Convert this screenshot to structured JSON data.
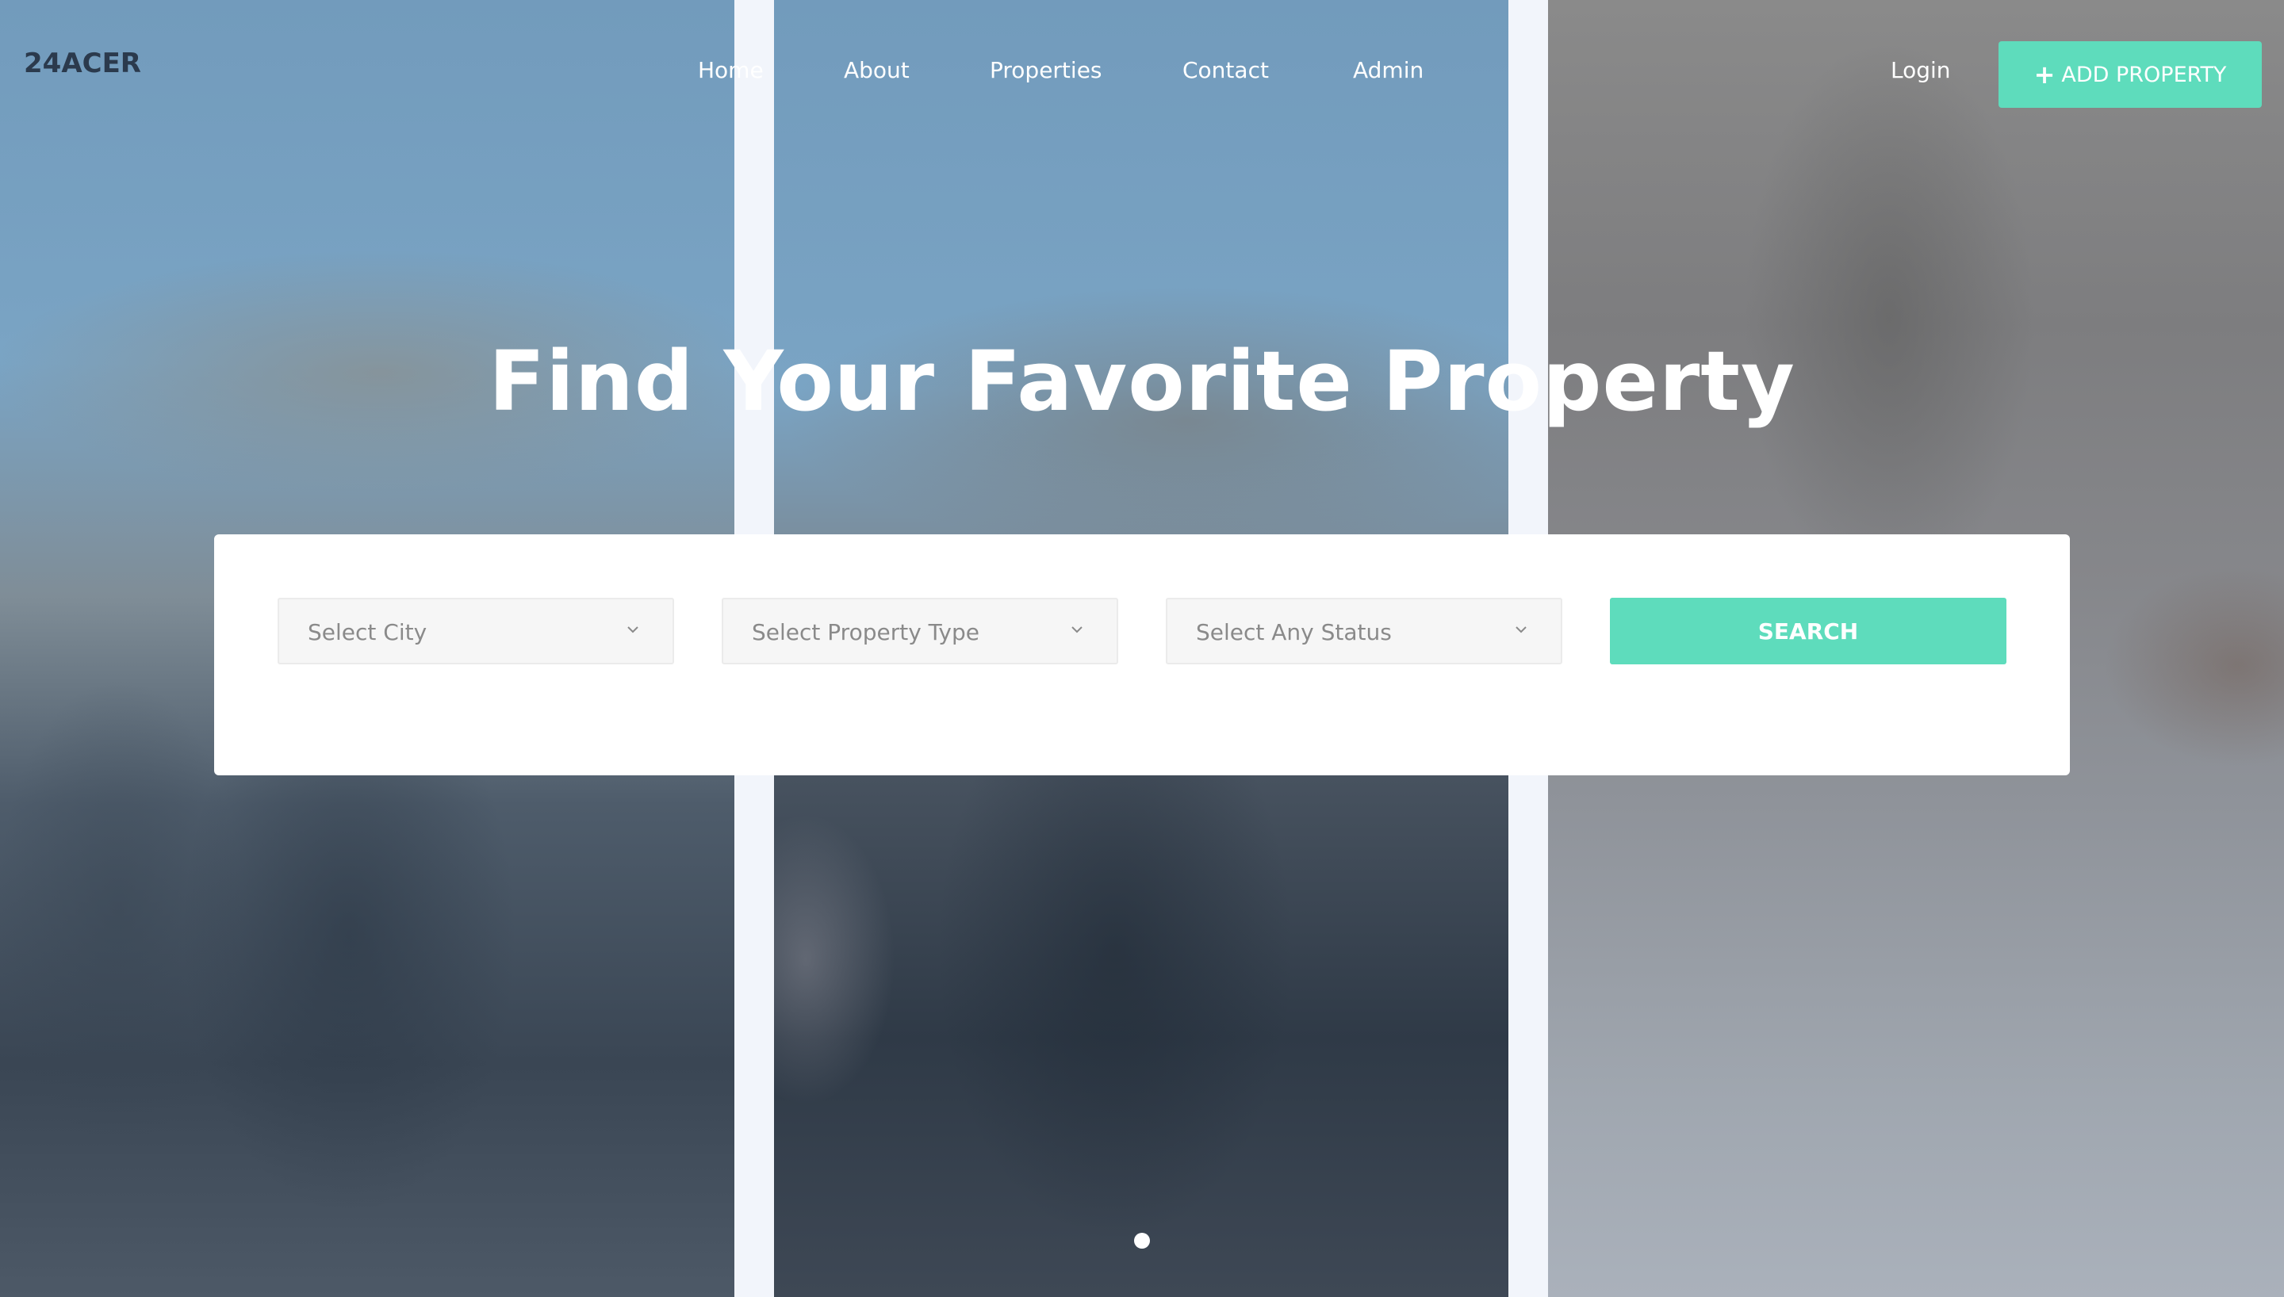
{
  "brand": {
    "logo": "24ACER"
  },
  "nav": {
    "items": [
      {
        "label": "Home"
      },
      {
        "label": "About"
      },
      {
        "label": "Properties"
      },
      {
        "label": "Contact"
      },
      {
        "label": "Admin"
      }
    ],
    "login": "Login",
    "add_property": "ADD PROPERTY"
  },
  "hero": {
    "title": "Find Your Favorite Property"
  },
  "search": {
    "city_placeholder": "Select City",
    "type_placeholder": "Select Property Type",
    "status_placeholder": "Select Any Status",
    "button": "SEARCH"
  },
  "slider": {
    "active_index": 1,
    "count": 1
  },
  "colors": {
    "accent": "#5edcbc",
    "logo": "#2b3a4d",
    "card": "#ffffff",
    "divider": "#f2f5fb"
  },
  "icons": {
    "add": "plus-icon",
    "select": "chevron-down-icon"
  }
}
